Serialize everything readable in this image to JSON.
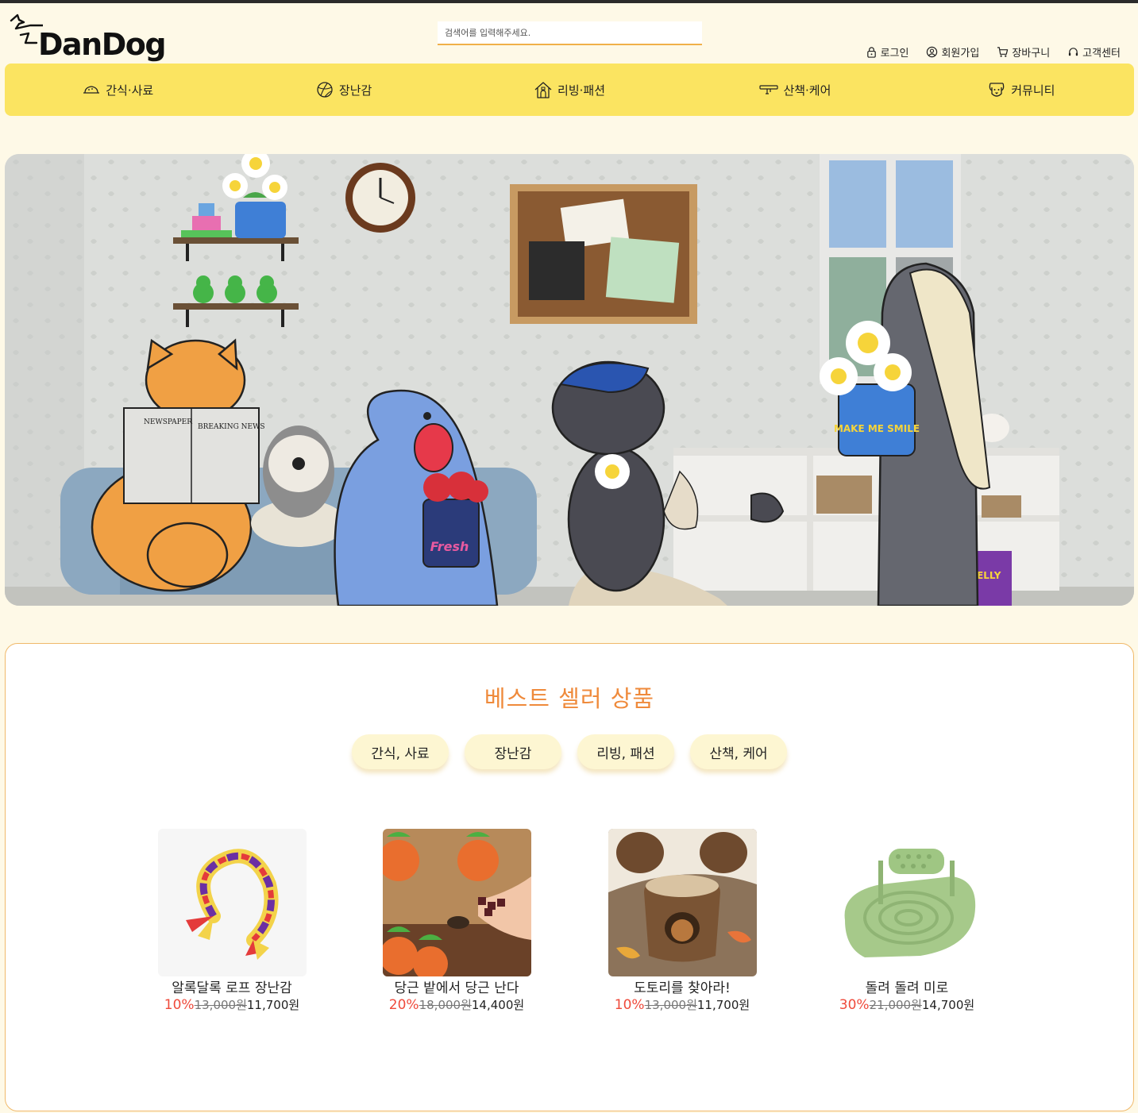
{
  "header": {
    "logo": "DanDog",
    "search_placeholder": "검색어를 입력해주세요.",
    "util": [
      {
        "label": "로그인",
        "icon": "lock-icon"
      },
      {
        "label": "회원가입",
        "icon": "user-circle-icon"
      },
      {
        "label": "장바구니",
        "icon": "cart-icon"
      },
      {
        "label": "고객센터",
        "icon": "headset-icon"
      }
    ]
  },
  "nav": {
    "items": [
      {
        "label": "간식·사료",
        "icon": "food-bowl-icon"
      },
      {
        "label": "장난감",
        "icon": "ball-icon"
      },
      {
        "label": "리빙·패션",
        "icon": "dog-house-icon"
      },
      {
        "label": "산책·케어",
        "icon": "leash-icon"
      },
      {
        "label": "커뮤니티",
        "icon": "dog-face-icon"
      }
    ]
  },
  "banner": {
    "newspaper_left": "NEWSPAPER",
    "newspaper_right": "BREAKING NEWS",
    "bucket_text": "MAKE ME SMILE",
    "fresh_text": "Fresh",
    "jelly_text": "JELLY"
  },
  "best": {
    "title": "베스트 셀러 상품",
    "categories": [
      "간식, 사료",
      "장난감",
      "리빙, 패션",
      "산책, 케어"
    ],
    "products": [
      {
        "name": "알록달록 로프 장난감",
        "discount": "10%",
        "original": "13,000원",
        "price": "11,700원"
      },
      {
        "name": "당근 밭에서 당근 난다",
        "discount": "20%",
        "original": "18,000원",
        "price": "14,400원"
      },
      {
        "name": "도토리를 찾아라!",
        "discount": "10%",
        "original": "13,000원",
        "price": "11,700원"
      },
      {
        "name": "돌려 돌려 미로",
        "discount": "30%",
        "original": "21,000원",
        "price": "14,700원"
      }
    ]
  },
  "colors": {
    "background": "#fef9e7",
    "nav": "#fbe461",
    "accent": "#ef8a3b",
    "discount": "#ef4a3b"
  }
}
